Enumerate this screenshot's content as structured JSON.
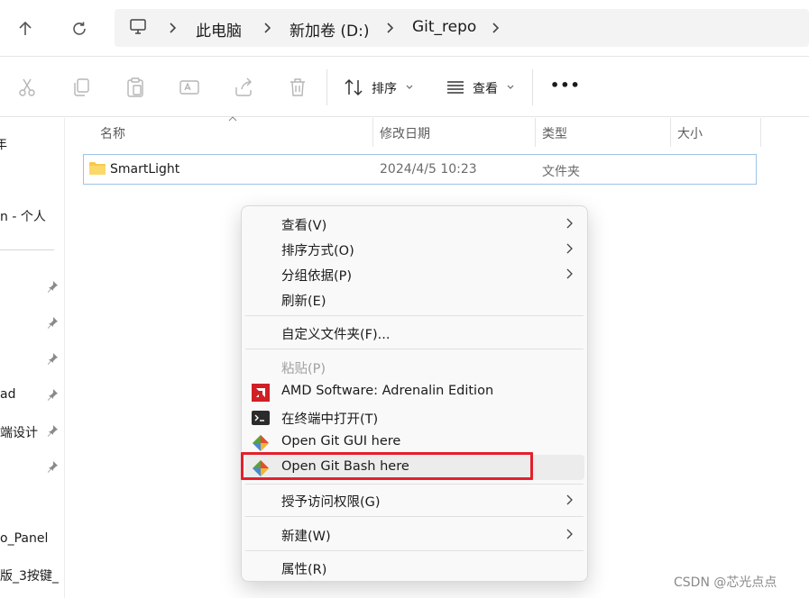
{
  "nav": {
    "up_icon": "arrow-up-icon",
    "refresh_icon": "refresh-icon"
  },
  "breadcrumb": {
    "items": [
      "此电脑",
      "新加卷 (D:)",
      "Git_repo"
    ]
  },
  "toolbar": {
    "sort_label": "排序",
    "view_label": "查看",
    "more_label": "•••"
  },
  "sidebar": {
    "items": [
      "年",
      "n - 个人",
      "ad",
      "端设计",
      "o_Panel",
      "版_3按键_"
    ]
  },
  "columns": {
    "name": "名称",
    "modified": "修改日期",
    "type": "类型",
    "size": "大小"
  },
  "files": [
    {
      "name": "SmartLight",
      "modified": "2024/4/5 10:23",
      "type": "文件夹",
      "size": ""
    }
  ],
  "context_menu": {
    "items": [
      {
        "label": "查看(V)",
        "submenu": true
      },
      {
        "label": "排序方式(O)",
        "submenu": true
      },
      {
        "label": "分组依据(P)",
        "submenu": true
      },
      {
        "label": "刷新(E)",
        "submenu": false
      },
      {
        "label": "自定义文件夹(F)...",
        "submenu": false
      },
      {
        "label": "粘贴(P)",
        "submenu": false,
        "disabled": true
      },
      {
        "label": "AMD Software: Adrenalin Edition",
        "submenu": false,
        "icon": "amd-icon"
      },
      {
        "label": "在终端中打开(T)",
        "submenu": false,
        "icon": "terminal-icon"
      },
      {
        "label": "Open Git GUI here",
        "submenu": false,
        "icon": "git-icon"
      },
      {
        "label": "Open Git Bash here",
        "submenu": false,
        "icon": "git-icon",
        "highlighted": true
      },
      {
        "label": "授予访问权限(G)",
        "submenu": true
      },
      {
        "label": "新建(W)",
        "submenu": true
      },
      {
        "label": "属性(R)",
        "submenu": false
      }
    ]
  },
  "colors": {
    "highlight_border": "#e3202c",
    "folder": "#f8c94a",
    "amd": "#d11f26"
  },
  "watermark": "CSDN @芯光点点"
}
